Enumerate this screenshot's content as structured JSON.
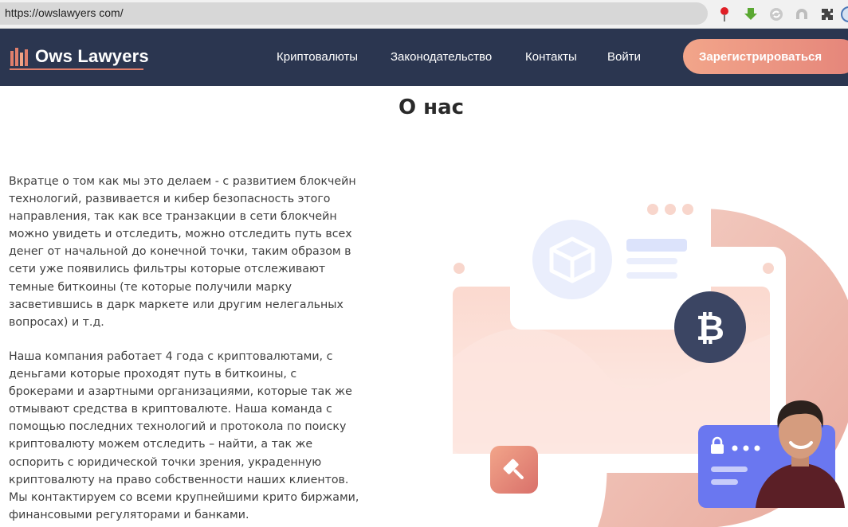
{
  "browser": {
    "url": "https://owslawyers com/"
  },
  "header": {
    "logo_text": "Ows Lawyers",
    "nav": {
      "crypto": "Криптовалюты",
      "law": "Законодательство",
      "contacts": "Контакты",
      "login": "Войти"
    },
    "register_label": "Зарегистрироваться"
  },
  "main": {
    "title": "О нас",
    "paragraph1": "Вкратце о том как мы это делаем - с развитием блокчейн технологий, развивается и кибер безопасность этого направления, так как все транзакции в сети блокчейн можно увидеть и отследить, можно отследить путь всех денег от начальной до конечной точки, таким образом в сети уже появились фильтры которые отслеживают темные биткоины (те которые получили марку засветившись в дарк маркете или другим нелегальных вопросах) и т.д.",
    "paragraph2": "Наша компания работает 4 года с криптовалютами, с деньгами которые проходят путь в биткоины, с брокерами и азартными организациями, которые так же отмывают средства в криптовалюте. Наша команда с помощью последних технологий и протокола по поиску криптовалюту можем отследить – найти, а так же оспорить с юридической точки зрения, украденную криптовалюту на право собственности наших клиентов. Мы контактируем со всеми крупнейшими крито биржами, финансовыми регуляторами и банками."
  },
  "colors": {
    "header_bg": "#2b3650",
    "accent": "#e5857a",
    "bitcoin_badge": "#3b4563"
  },
  "illustration": {
    "bitcoin_symbol": "₿"
  }
}
